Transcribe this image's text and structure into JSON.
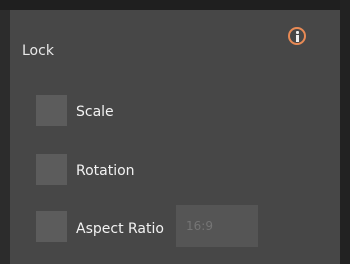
{
  "panel": {
    "title": "Lock",
    "info_icon": "info-icon"
  },
  "options": {
    "scale": {
      "label": "Scale",
      "checked": false
    },
    "rotation": {
      "label": "Rotation",
      "checked": false
    },
    "aspect_ratio": {
      "label": "Aspect Ratio",
      "checked": false,
      "placeholder": "16:9"
    }
  },
  "colors": {
    "accent": "#e88a55",
    "panel_bg": "#474747",
    "checkbox_bg": "#5c5c5c"
  }
}
